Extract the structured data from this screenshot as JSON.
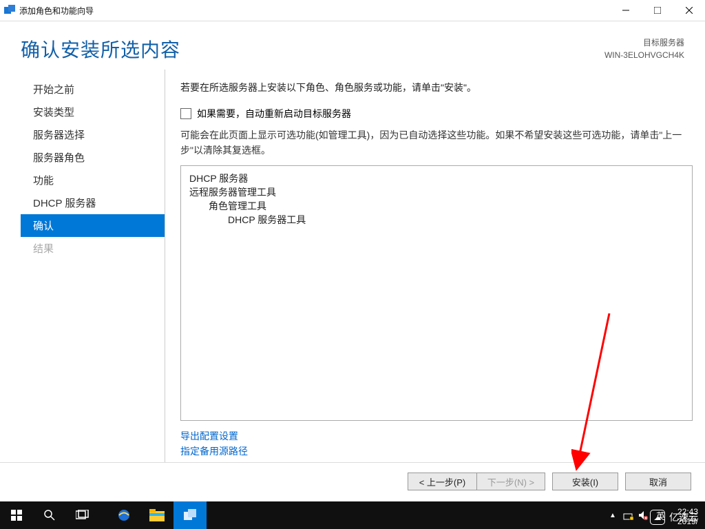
{
  "titlebar": {
    "title": "添加角色和功能向导"
  },
  "header": {
    "heading": "确认安装所选内容",
    "target_label": "目标服务器",
    "target_value": "WIN-3ELOHVGCH4K"
  },
  "nav": {
    "items": [
      {
        "label": "开始之前",
        "state": "normal"
      },
      {
        "label": "安装类型",
        "state": "normal"
      },
      {
        "label": "服务器选择",
        "state": "normal"
      },
      {
        "label": "服务器角色",
        "state": "normal"
      },
      {
        "label": "功能",
        "state": "normal"
      },
      {
        "label": "DHCP 服务器",
        "state": "normal"
      },
      {
        "label": "确认",
        "state": "selected"
      },
      {
        "label": "结果",
        "state": "disabled"
      }
    ]
  },
  "content": {
    "intro": "若要在所选服务器上安装以下角色、角色服务或功能，请单击\"安装\"。",
    "checkbox_label": "如果需要，自动重新启动目标服务器",
    "note": "可能会在此页面上显示可选功能(如管理工具)，因为已自动选择这些功能。如果不希望安装这些可选功能，请单击\"上一步\"以清除其复选框。",
    "items": [
      {
        "text": "DHCP 服务器",
        "level": 1
      },
      {
        "text": "远程服务器管理工具",
        "level": 1
      },
      {
        "text": "角色管理工具",
        "level": 2
      },
      {
        "text": "DHCP 服务器工具",
        "level": 3
      }
    ],
    "link_export": "导出配置设置",
    "link_altsource": "指定备用源路径"
  },
  "footer": {
    "prev": "< 上一步(P)",
    "next": "下一步(N) >",
    "install": "安装(I)",
    "cancel": "取消"
  },
  "taskbar": {
    "ime": "英",
    "time": "22:43",
    "date": "2019/"
  },
  "watermark": {
    "text": "亿速云"
  }
}
